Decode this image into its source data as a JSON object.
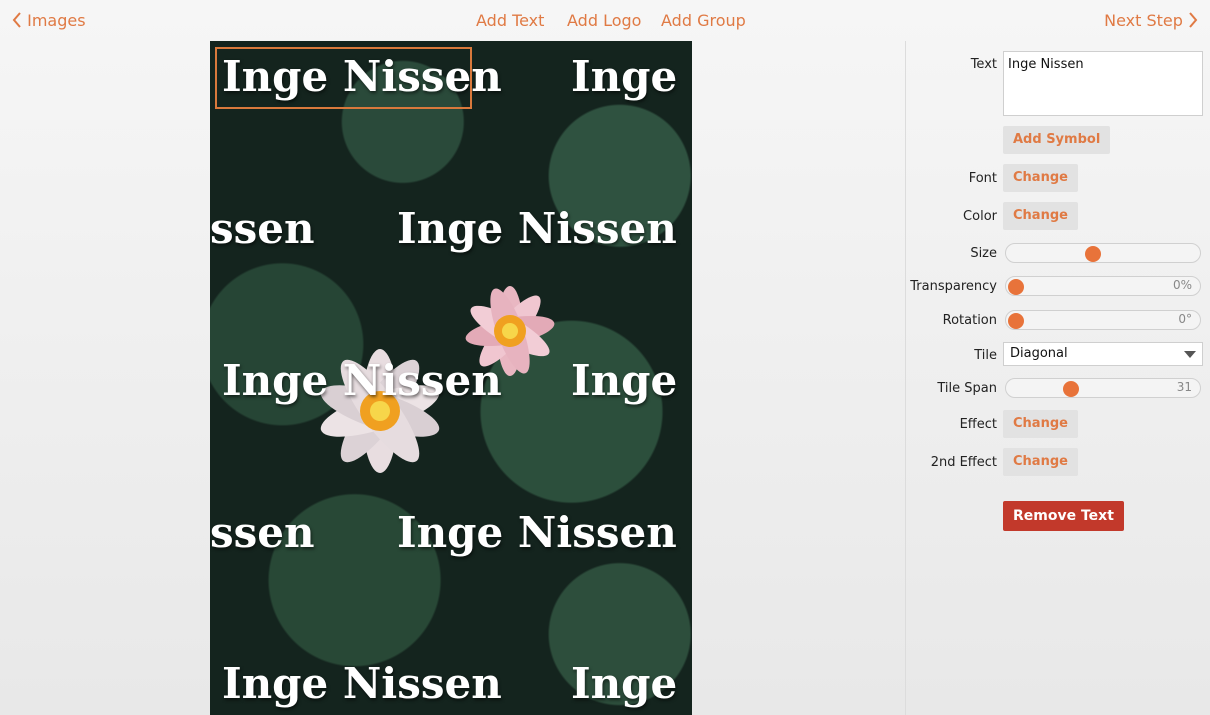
{
  "nav": {
    "back_label": "Images",
    "add_text": "Add Text",
    "add_logo": "Add Logo",
    "add_group": "Add Group",
    "next_label": "Next Step",
    "accent_color": "#e07a44"
  },
  "canvas": {
    "watermark_text": "Inge Nissen",
    "watermark_partial_left": "ssen",
    "watermark_partial_right": "Inge N"
  },
  "panel": {
    "text_label": "Text",
    "text_value": "Inge Nissen",
    "add_symbol": "Add Symbol",
    "font_label": "Font",
    "font_button": "Change",
    "color_label": "Color",
    "color_button": "Change",
    "size_label": "Size",
    "size_value": 0.44,
    "transparency_label": "Transparency",
    "transparency_value": 0,
    "transparency_display": "0%",
    "rotation_label": "Rotation",
    "rotation_value": 0,
    "rotation_display": "0°",
    "tile_label": "Tile",
    "tile_value": "Diagonal",
    "tile_span_label": "Tile Span",
    "tile_span_value": 31,
    "tile_span_display": "31",
    "effect_label": "Effect",
    "effect_button": "Change",
    "effect2_label": "2nd Effect",
    "effect2_button": "Change",
    "remove_label": "Remove Text",
    "remove_color": "#c2392b",
    "slider_knob_color": "#e8733a"
  }
}
